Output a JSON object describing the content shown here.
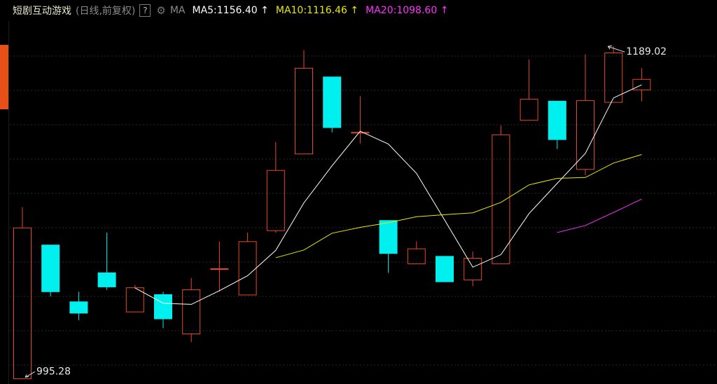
{
  "header": {
    "title": "短剧互动游戏",
    "subtitle": "(日线,前复权)",
    "help": "?",
    "gear_icon": "gear-icon",
    "ma_label": "MA",
    "ma5": "MA5:1156.40",
    "ma10": "MA10:1116.46",
    "ma20": "MA20:1098.60",
    "arrow": "↑"
  },
  "colors": {
    "up": "#e8472b",
    "down": "#00f0f0",
    "ma5": "#ffffff",
    "ma10": "#e8e800",
    "ma20": "#ff33ff",
    "grid": "#2a2a2a",
    "background": "#000000"
  },
  "chart_data": {
    "type": "candlestick",
    "ylim": [
      993,
      1203
    ],
    "grid": true,
    "high_label": "1189.02",
    "low_label": "995.28",
    "candles": [
      {
        "open": 995.28,
        "close": 1083.2,
        "high": 1095.3,
        "low": 995.28
      },
      {
        "open": 1073.2,
        "close": 1046.0,
        "high": 1073.2,
        "low": 1043.2
      },
      {
        "open": 1040.1,
        "close": 1033.5,
        "high": 1046.0,
        "low": 1029.4
      },
      {
        "open": 1057.0,
        "close": 1048.8,
        "high": 1080.4,
        "low": 1047.1
      },
      {
        "open": 1034.2,
        "close": 1048.3,
        "high": 1049.9,
        "low": 1034.2
      },
      {
        "open": 1044.3,
        "close": 1030.2,
        "high": 1046.0,
        "low": 1024.8
      },
      {
        "open": 1021.4,
        "close": 1047.1,
        "high": 1054.0,
        "low": 1016.6
      },
      {
        "open": 1059.4,
        "close": 1059.4,
        "high": 1075.2,
        "low": 1046.0
      },
      {
        "open": 1044.1,
        "close": 1075.2,
        "high": 1080.4,
        "low": 1044.1
      },
      {
        "open": 1081.6,
        "close": 1116.7,
        "high": 1133.2,
        "low": 1080.4
      },
      {
        "open": 1126.3,
        "close": 1176.3,
        "high": 1186.8,
        "low": 1126.3
      },
      {
        "open": 1171.2,
        "close": 1141.7,
        "high": 1171.2,
        "low": 1138.9
      },
      {
        "open": 1138.9,
        "close": 1138.9,
        "high": 1160.0,
        "low": 1132.4
      },
      {
        "open": 1087.5,
        "close": 1068.3,
        "high": 1087.5,
        "low": 1057.0
      },
      {
        "open": 1062.3,
        "close": 1071.0,
        "high": 1075.3,
        "low": 1062.3
      },
      {
        "open": 1066.6,
        "close": 1051.8,
        "high": 1066.6,
        "low": 1051.8
      },
      {
        "open": 1052.8,
        "close": 1065.5,
        "high": 1069.4,
        "low": 1049.2
      },
      {
        "open": 1062.3,
        "close": 1137.5,
        "high": 1143.0,
        "low": 1062.3
      },
      {
        "open": 1145.9,
        "close": 1158.2,
        "high": 1181.4,
        "low": 1145.9
      },
      {
        "open": 1157.1,
        "close": 1134.7,
        "high": 1157.1,
        "low": 1129.2
      },
      {
        "open": 1117.3,
        "close": 1157.4,
        "high": 1184.4,
        "low": 1114.0
      },
      {
        "open": 1156.4,
        "close": 1185.2,
        "high": 1189.02,
        "low": 1156.4
      },
      {
        "open": 1163.7,
        "close": 1169.8,
        "high": 1176.3,
        "low": 1156.9
      }
    ],
    "series": [
      {
        "name": "MA5",
        "values": [
          null,
          null,
          null,
          null,
          1048.2,
          1039.3,
          1038.6,
          1046.6,
          1055.3,
          1070.1,
          1097.8,
          1119.4,
          1139.6,
          1132.1,
          1115.0,
          1087.8,
          1060.3,
          1067.6,
          1091.6,
          1109.2,
          1126.7,
          1159.0,
          1166.6
        ]
      },
      {
        "name": "MA10",
        "values": [
          null,
          null,
          null,
          null,
          null,
          null,
          null,
          null,
          null,
          1065.8,
          1070.3,
          1080.1,
          1083.5,
          1086.2,
          1089.7,
          1090.9,
          1092.0,
          1098.1,
          1108.3,
          1112.1,
          1112.6,
          1121.0,
          1126.0
        ]
      },
      {
        "name": "MA20",
        "values": [
          null,
          null,
          null,
          null,
          null,
          null,
          null,
          null,
          null,
          null,
          null,
          null,
          null,
          null,
          null,
          null,
          null,
          null,
          null,
          1080.5,
          1084.6,
          1092.2,
          1100.0
        ]
      }
    ]
  }
}
